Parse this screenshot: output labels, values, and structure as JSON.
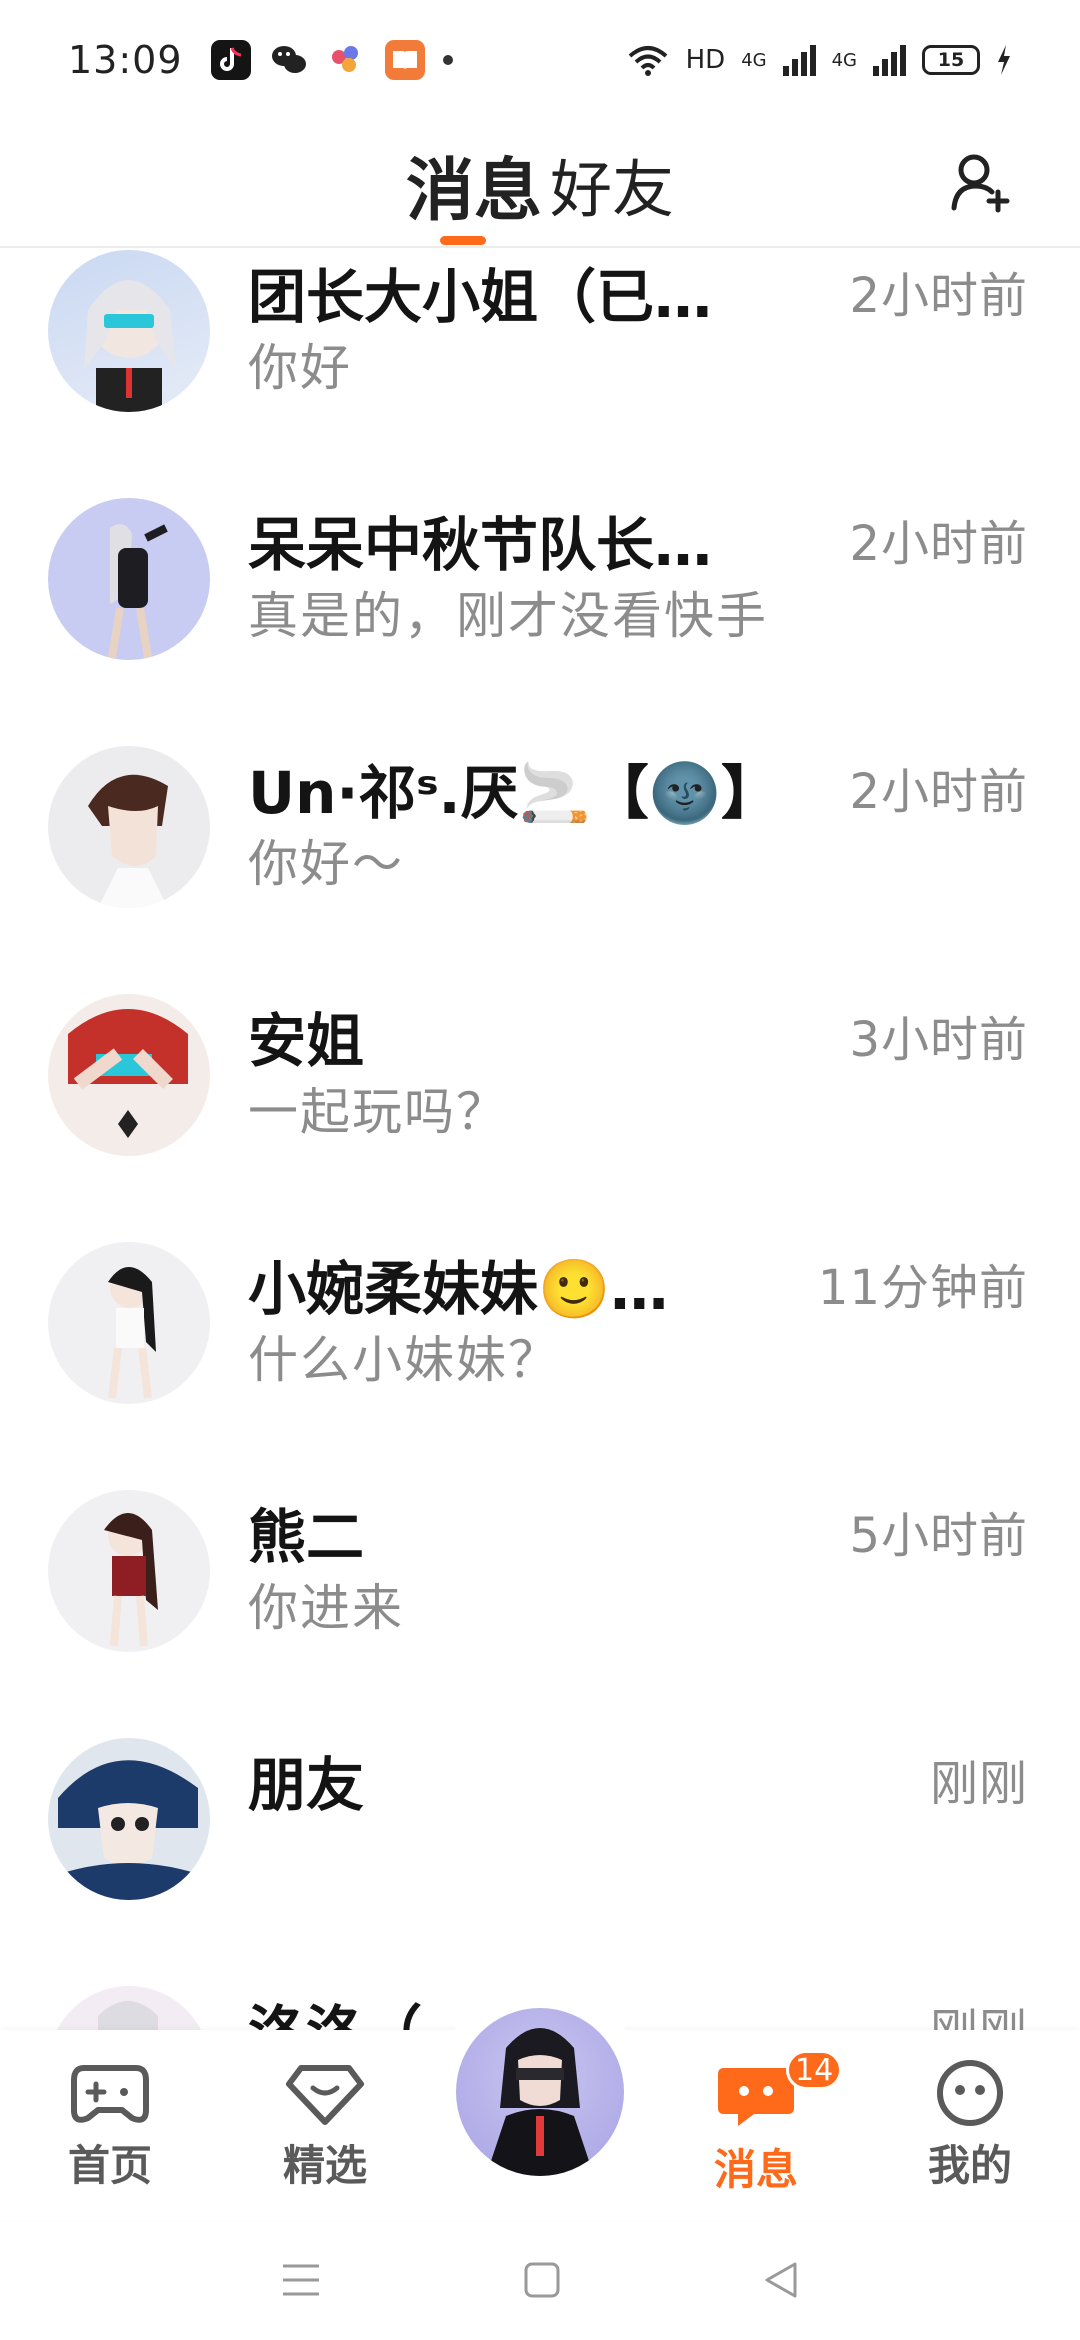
{
  "status_bar": {
    "time": "13:09",
    "network": "HD",
    "signal1": "4G",
    "signal2": "4G",
    "battery": "15"
  },
  "header": {
    "tabs": [
      {
        "label": "消息",
        "active": true
      },
      {
        "label": "好友",
        "active": false
      }
    ],
    "accent_color": "#ff6a1a"
  },
  "chats": [
    {
      "name": "团长大小姐（已…",
      "preview": "你好",
      "time": "2小时前"
    },
    {
      "name": "呆呆中秋节队长…",
      "preview": "真是的，刚才没看快手",
      "time": "2小时前"
    },
    {
      "name": "Un·祁ˢ.厌🚬【🌚】",
      "preview": "你好～",
      "time": "2小时前"
    },
    {
      "name": "安姐",
      "preview": "一起玩吗？",
      "time": "3小时前"
    },
    {
      "name": "小婉柔妹妹🙂…",
      "preview": "什么小妹妹？",
      "time": "11分钟前"
    },
    {
      "name": "熊二",
      "preview": "你进来",
      "time": "5小时前"
    },
    {
      "name": "朋友",
      "preview": "",
      "time": "刚刚"
    },
    {
      "name": "洛洛（",
      "preview": "",
      "time": "刚刚"
    }
  ],
  "bottom_nav": {
    "items": [
      {
        "label": "首页",
        "icon": "gamepad-icon"
      },
      {
        "label": "精选",
        "icon": "heart-badge-icon"
      },
      {
        "label": "消息",
        "icon": "message-icon",
        "badge": "14"
      },
      {
        "label": "我的",
        "icon": "face-icon"
      }
    ]
  }
}
